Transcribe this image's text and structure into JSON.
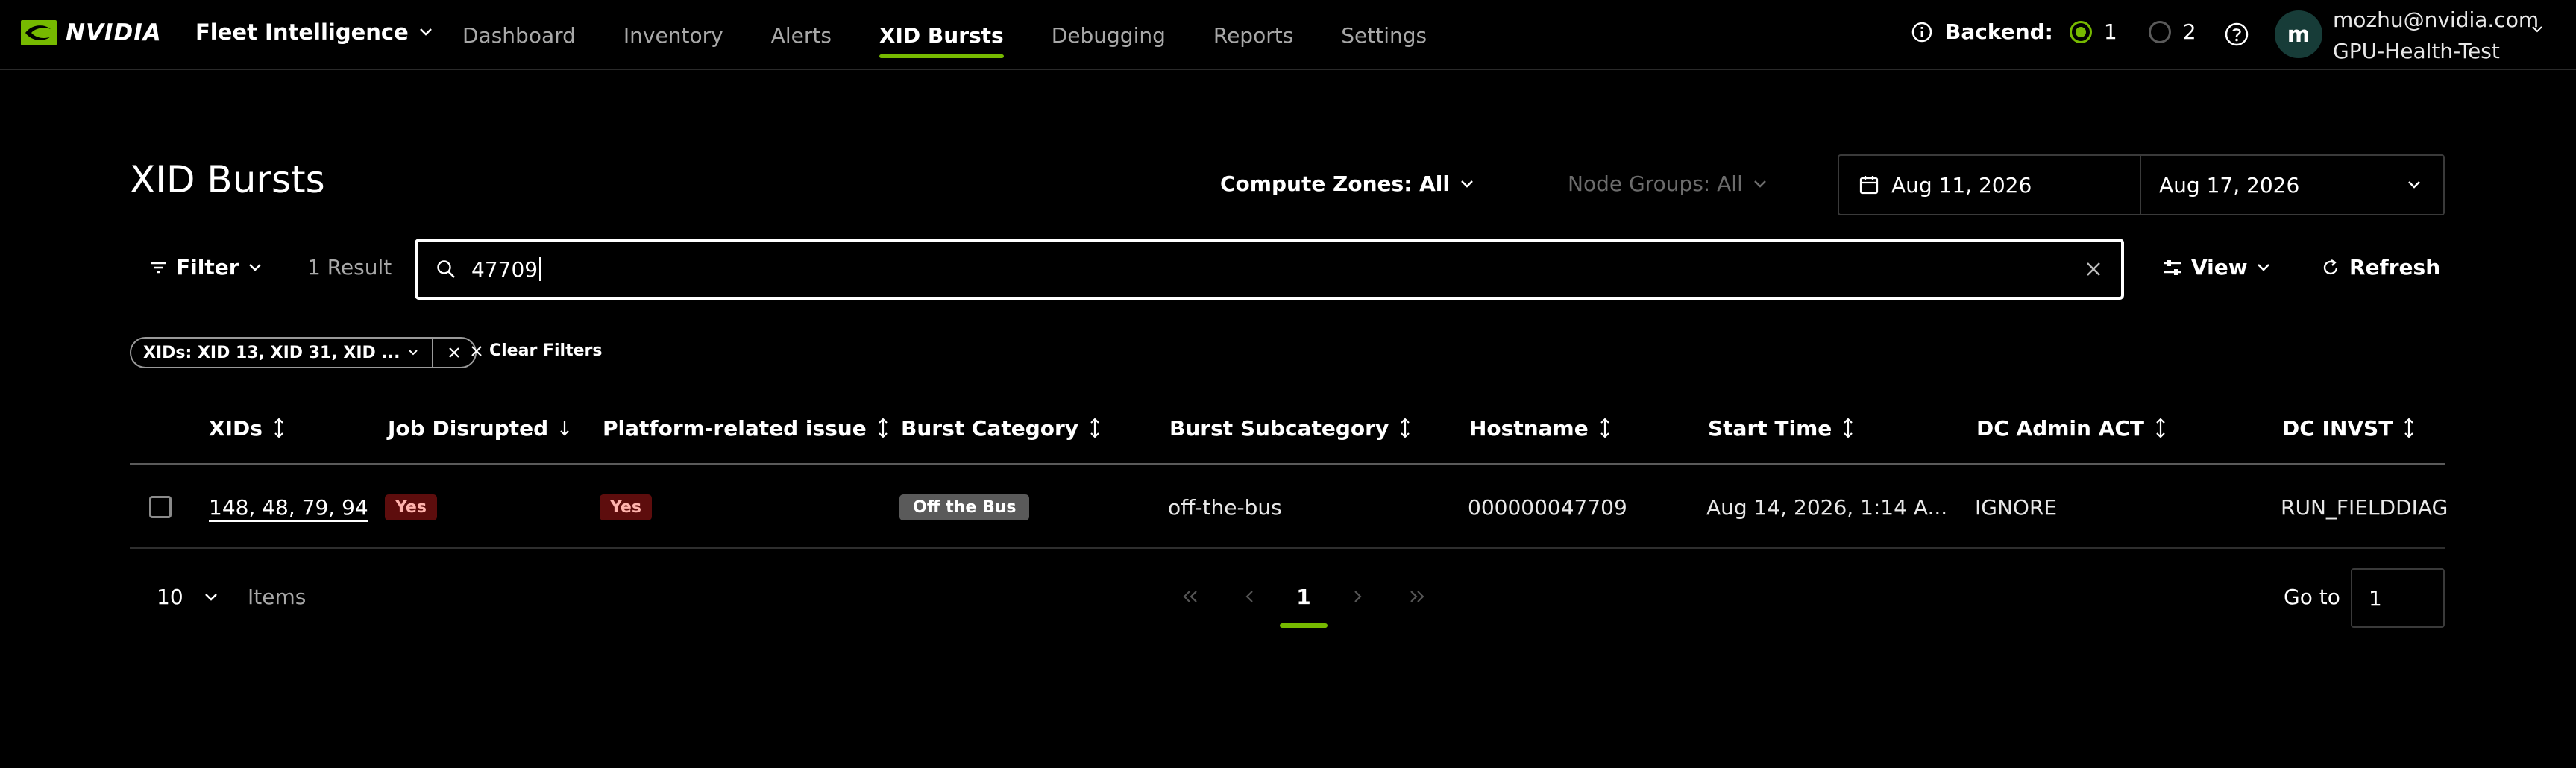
{
  "nav": {
    "brand": "NVIDIA",
    "app_name": "Fleet Intelligence",
    "links": [
      "Dashboard",
      "Inventory",
      "Alerts",
      "XID Bursts",
      "Debugging",
      "Reports",
      "Settings"
    ],
    "active_link": "XID Bursts",
    "backend_label": "Backend:",
    "backend_options": [
      "1",
      "2"
    ],
    "backend_selected": "1",
    "avatar_initial": "m",
    "user_email": "mozhu@nvidia.com",
    "user_org": "GPU-Health-Test"
  },
  "page": {
    "title": "XID Bursts",
    "compute_zones": "Compute Zones: All",
    "node_groups": "Node Groups: All",
    "date_start": "Aug 11, 2026",
    "date_end": "Aug 17, 2026"
  },
  "toolbar": {
    "filter_label": "Filter",
    "result_count": "1 Result",
    "search_value": "47709",
    "view_label": "View",
    "refresh_label": "Refresh"
  },
  "filters": {
    "chip_label": "XIDs: XID 13, XID 31, XID ...",
    "clear_label": "Clear Filters"
  },
  "table": {
    "columns": [
      "XIDs",
      "Job Disrupted",
      "Platform-related issue",
      "Burst Category",
      "Burst Subcategory",
      "Hostname",
      "Start Time",
      "DC Admin ACT",
      "DC INVST"
    ],
    "rows": [
      {
        "xids": "148, 48, 79, 94",
        "job_disrupted": "Yes",
        "platform_issue": "Yes",
        "burst_category": "Off the Bus",
        "burst_subcategory": "off-the-bus",
        "hostname": "000000047709",
        "start_time": "Aug 14, 2026, 1:14 A...",
        "dc_admin_act": "IGNORE",
        "dc_invst": "RUN_FIELDDIAG"
      }
    ]
  },
  "pagination": {
    "page_size": "10",
    "items_label": "Items",
    "current_page": "1",
    "goto_label": "Go to",
    "goto_value": "1"
  },
  "colors": {
    "accent": "#76b900",
    "background": "#000000",
    "badge_red_bg": "#5d0d0d",
    "badge_gray_bg": "#5a5a5a"
  }
}
